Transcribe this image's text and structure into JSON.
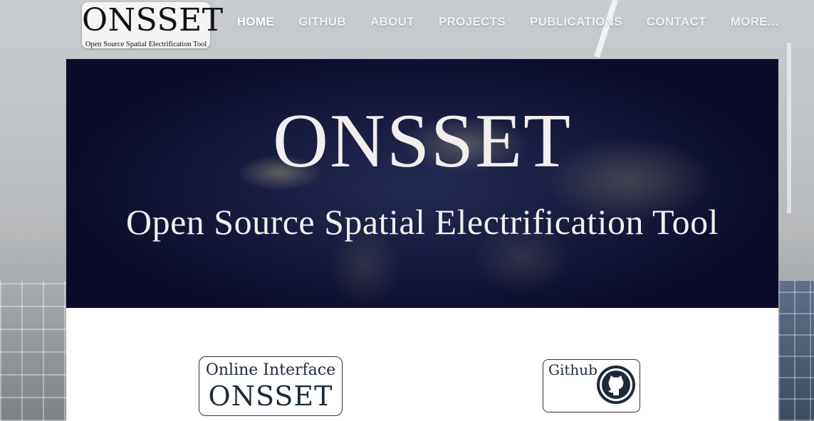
{
  "logo": {
    "title": "ONSSET",
    "subtitle": "Open Source Spatial Electrification Tool"
  },
  "nav": {
    "items": [
      {
        "label": "HOME",
        "active": true
      },
      {
        "label": "GITHUB"
      },
      {
        "label": "ABOUT"
      },
      {
        "label": "PROJECTS"
      },
      {
        "label": "PUBLICATIONS"
      },
      {
        "label": "CONTACT"
      },
      {
        "label": "MORE..."
      }
    ]
  },
  "hero": {
    "title": "ONSSET",
    "subtitle": "Open Source Spatial Electrification Tool"
  },
  "cards": {
    "online_interface": {
      "line1": "Online Interface",
      "line2": "ONSSET"
    },
    "github": {
      "label": "Github",
      "icon": "github-icon"
    }
  },
  "colors": {
    "hero_bg": "#0b0c2a",
    "card_text": "#1e2a38",
    "github_icon_ring": "#1e2a38"
  }
}
